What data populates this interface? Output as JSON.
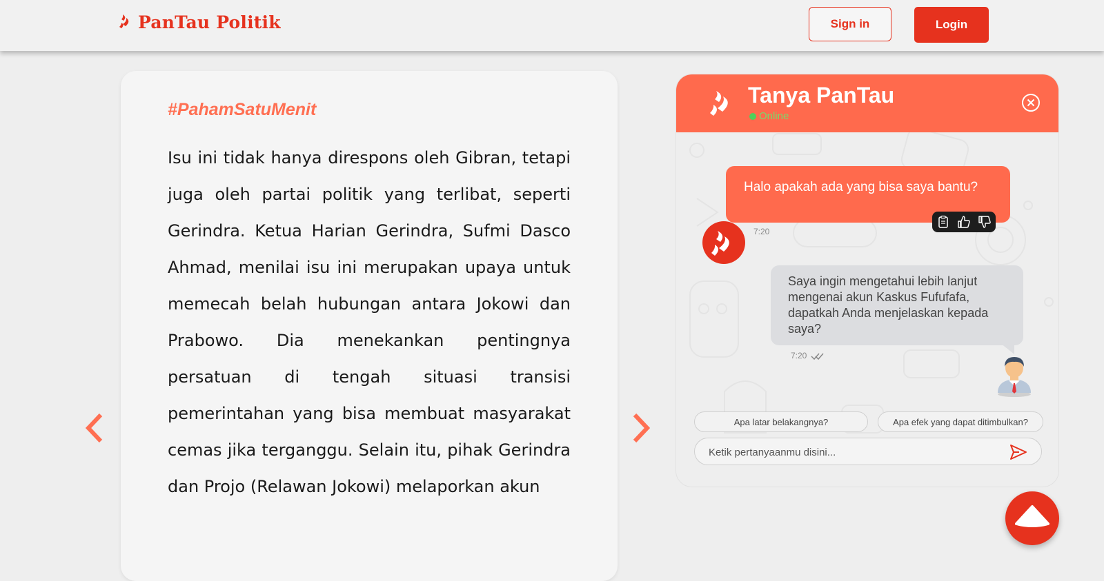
{
  "header": {
    "brand_name": "PanTau Politik",
    "brand_icon": "pantau-logo-icon",
    "signin_label": "Sign in",
    "login_label": "Login"
  },
  "article": {
    "hashtag": "#PahamSatuMenit",
    "text": "Isu ini tidak hanya direspons oleh Gibran, tetapi juga oleh partai politik yang terlibat, seperti Gerindra. Ketua Harian Gerindra, Sufmi Dasco Ahmad, menilai isu ini merupakan upaya untuk memecah belah hubungan antara Jokowi dan Prabowo. Dia menekankan pentingnya persatuan di tengah situasi transisi pemerintahan yang bisa membuat masyarakat cemas jika terganggu. Selain itu, pihak Gerindra dan Projo (Relawan Jokowi) melaporkan akun",
    "prev_icon": "chevron-left-icon",
    "next_icon": "chevron-right-icon"
  },
  "chat": {
    "title": "Tanya PanTau",
    "status": "Online",
    "messages": [
      {
        "from": "bot",
        "text": "Halo apakah ada yang bisa saya bantu?",
        "time": "7:20"
      },
      {
        "from": "user",
        "text": "Saya ingin mengetahui lebih lanjut mengenai akun Kaskus Fufufafa, dapatkah Anda menjelaskan kepada saya?",
        "time": "7:20"
      }
    ],
    "suggestions": [
      "Apa latar belakangnya?",
      "Apa efek yang dapat ditimbulkan?"
    ],
    "input_placeholder": "Ketik pertanyaanmu disini...",
    "colors": {
      "accent": "#ff6a4d",
      "brand": "#e6321e",
      "user_bubble": "#dcdde0"
    }
  }
}
